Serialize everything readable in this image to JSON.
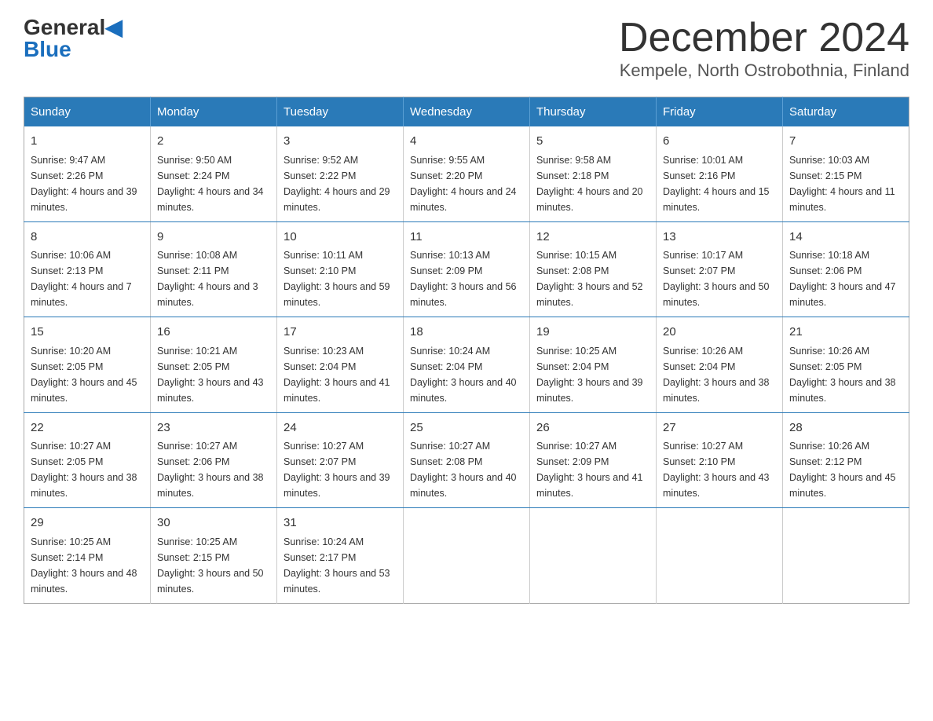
{
  "header": {
    "logo_line1": "General",
    "logo_line2": "Blue",
    "month_title": "December 2024",
    "location": "Kempele, North Ostrobothnia, Finland"
  },
  "days_of_week": [
    "Sunday",
    "Monday",
    "Tuesday",
    "Wednesday",
    "Thursday",
    "Friday",
    "Saturday"
  ],
  "weeks": [
    [
      {
        "day": "1",
        "sunrise": "Sunrise: 9:47 AM",
        "sunset": "Sunset: 2:26 PM",
        "daylight": "Daylight: 4 hours and 39 minutes."
      },
      {
        "day": "2",
        "sunrise": "Sunrise: 9:50 AM",
        "sunset": "Sunset: 2:24 PM",
        "daylight": "Daylight: 4 hours and 34 minutes."
      },
      {
        "day": "3",
        "sunrise": "Sunrise: 9:52 AM",
        "sunset": "Sunset: 2:22 PM",
        "daylight": "Daylight: 4 hours and 29 minutes."
      },
      {
        "day": "4",
        "sunrise": "Sunrise: 9:55 AM",
        "sunset": "Sunset: 2:20 PM",
        "daylight": "Daylight: 4 hours and 24 minutes."
      },
      {
        "day": "5",
        "sunrise": "Sunrise: 9:58 AM",
        "sunset": "Sunset: 2:18 PM",
        "daylight": "Daylight: 4 hours and 20 minutes."
      },
      {
        "day": "6",
        "sunrise": "Sunrise: 10:01 AM",
        "sunset": "Sunset: 2:16 PM",
        "daylight": "Daylight: 4 hours and 15 minutes."
      },
      {
        "day": "7",
        "sunrise": "Sunrise: 10:03 AM",
        "sunset": "Sunset: 2:15 PM",
        "daylight": "Daylight: 4 hours and 11 minutes."
      }
    ],
    [
      {
        "day": "8",
        "sunrise": "Sunrise: 10:06 AM",
        "sunset": "Sunset: 2:13 PM",
        "daylight": "Daylight: 4 hours and 7 minutes."
      },
      {
        "day": "9",
        "sunrise": "Sunrise: 10:08 AM",
        "sunset": "Sunset: 2:11 PM",
        "daylight": "Daylight: 4 hours and 3 minutes."
      },
      {
        "day": "10",
        "sunrise": "Sunrise: 10:11 AM",
        "sunset": "Sunset: 2:10 PM",
        "daylight": "Daylight: 3 hours and 59 minutes."
      },
      {
        "day": "11",
        "sunrise": "Sunrise: 10:13 AM",
        "sunset": "Sunset: 2:09 PM",
        "daylight": "Daylight: 3 hours and 56 minutes."
      },
      {
        "day": "12",
        "sunrise": "Sunrise: 10:15 AM",
        "sunset": "Sunset: 2:08 PM",
        "daylight": "Daylight: 3 hours and 52 minutes."
      },
      {
        "day": "13",
        "sunrise": "Sunrise: 10:17 AM",
        "sunset": "Sunset: 2:07 PM",
        "daylight": "Daylight: 3 hours and 50 minutes."
      },
      {
        "day": "14",
        "sunrise": "Sunrise: 10:18 AM",
        "sunset": "Sunset: 2:06 PM",
        "daylight": "Daylight: 3 hours and 47 minutes."
      }
    ],
    [
      {
        "day": "15",
        "sunrise": "Sunrise: 10:20 AM",
        "sunset": "Sunset: 2:05 PM",
        "daylight": "Daylight: 3 hours and 45 minutes."
      },
      {
        "day": "16",
        "sunrise": "Sunrise: 10:21 AM",
        "sunset": "Sunset: 2:05 PM",
        "daylight": "Daylight: 3 hours and 43 minutes."
      },
      {
        "day": "17",
        "sunrise": "Sunrise: 10:23 AM",
        "sunset": "Sunset: 2:04 PM",
        "daylight": "Daylight: 3 hours and 41 minutes."
      },
      {
        "day": "18",
        "sunrise": "Sunrise: 10:24 AM",
        "sunset": "Sunset: 2:04 PM",
        "daylight": "Daylight: 3 hours and 40 minutes."
      },
      {
        "day": "19",
        "sunrise": "Sunrise: 10:25 AM",
        "sunset": "Sunset: 2:04 PM",
        "daylight": "Daylight: 3 hours and 39 minutes."
      },
      {
        "day": "20",
        "sunrise": "Sunrise: 10:26 AM",
        "sunset": "Sunset: 2:04 PM",
        "daylight": "Daylight: 3 hours and 38 minutes."
      },
      {
        "day": "21",
        "sunrise": "Sunrise: 10:26 AM",
        "sunset": "Sunset: 2:05 PM",
        "daylight": "Daylight: 3 hours and 38 minutes."
      }
    ],
    [
      {
        "day": "22",
        "sunrise": "Sunrise: 10:27 AM",
        "sunset": "Sunset: 2:05 PM",
        "daylight": "Daylight: 3 hours and 38 minutes."
      },
      {
        "day": "23",
        "sunrise": "Sunrise: 10:27 AM",
        "sunset": "Sunset: 2:06 PM",
        "daylight": "Daylight: 3 hours and 38 minutes."
      },
      {
        "day": "24",
        "sunrise": "Sunrise: 10:27 AM",
        "sunset": "Sunset: 2:07 PM",
        "daylight": "Daylight: 3 hours and 39 minutes."
      },
      {
        "day": "25",
        "sunrise": "Sunrise: 10:27 AM",
        "sunset": "Sunset: 2:08 PM",
        "daylight": "Daylight: 3 hours and 40 minutes."
      },
      {
        "day": "26",
        "sunrise": "Sunrise: 10:27 AM",
        "sunset": "Sunset: 2:09 PM",
        "daylight": "Daylight: 3 hours and 41 minutes."
      },
      {
        "day": "27",
        "sunrise": "Sunrise: 10:27 AM",
        "sunset": "Sunset: 2:10 PM",
        "daylight": "Daylight: 3 hours and 43 minutes."
      },
      {
        "day": "28",
        "sunrise": "Sunrise: 10:26 AM",
        "sunset": "Sunset: 2:12 PM",
        "daylight": "Daylight: 3 hours and 45 minutes."
      }
    ],
    [
      {
        "day": "29",
        "sunrise": "Sunrise: 10:25 AM",
        "sunset": "Sunset: 2:14 PM",
        "daylight": "Daylight: 3 hours and 48 minutes."
      },
      {
        "day": "30",
        "sunrise": "Sunrise: 10:25 AM",
        "sunset": "Sunset: 2:15 PM",
        "daylight": "Daylight: 3 hours and 50 minutes."
      },
      {
        "day": "31",
        "sunrise": "Sunrise: 10:24 AM",
        "sunset": "Sunset: 2:17 PM",
        "daylight": "Daylight: 3 hours and 53 minutes."
      },
      null,
      null,
      null,
      null
    ]
  ]
}
